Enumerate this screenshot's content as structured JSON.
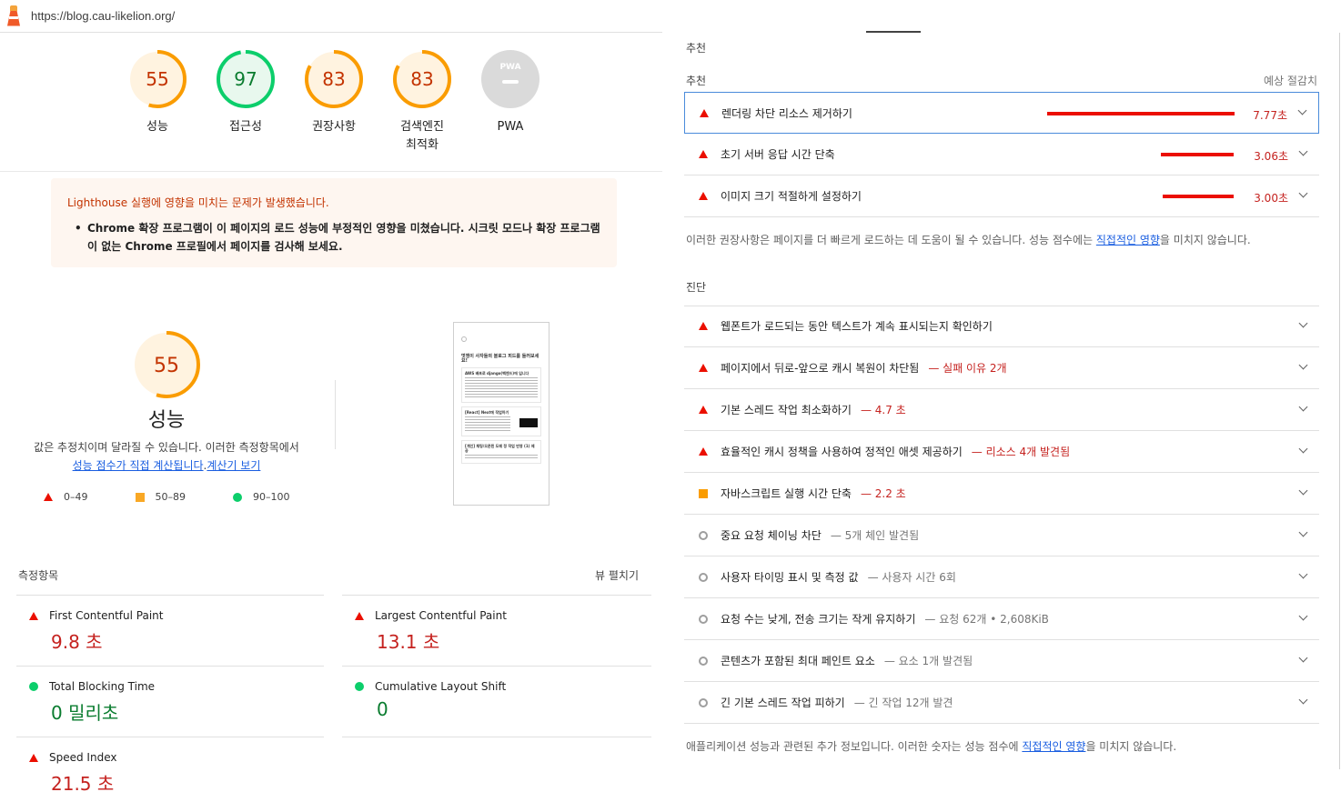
{
  "browser": {
    "url": "https://blog.cau-likelion.org/"
  },
  "gauges": [
    {
      "label": "성능",
      "score": "55",
      "color": "#fa9c00",
      "value": 0.55
    },
    {
      "label": "접근성",
      "score": "97",
      "color": "#0cce6b",
      "value": 0.97
    },
    {
      "label": "권장사항",
      "score": "83",
      "color": "#fa9c00",
      "value": 0.83
    },
    {
      "label": "검색엔진 최적화",
      "score": "83",
      "color": "#fa9c00",
      "value": 0.83
    },
    {
      "label": "PWA",
      "score": "PWA",
      "color": "#9e9e9e",
      "value": 1.0
    }
  ],
  "warning": {
    "title": "Lighthouse 실행에 영향을 미치는 문제가 발생했습니다.",
    "items": [
      "Chrome 확장 프로그램이 이 페이지의 로드 성능에 부정적인 영향을 미쳤습니다. 시크릿 모드나 확장 프로그램이 없는 Chrome 프로필에서 페이지를 검사해 보세요."
    ]
  },
  "performance": {
    "score": "55",
    "title": "성능",
    "desc_prefix": "값은 추정치이며 달라질 수 있습니다. 이러한 측정항목에서",
    "desc_link1": "성능 점수가 직접 계산됩니다",
    "desc_mid": ".",
    "desc_link2": "계산기 보기",
    "legend": [
      "0–49",
      "50–89",
      "90–100"
    ]
  },
  "metrics": {
    "title": "측정항목",
    "expand": "뷰 펼치기",
    "items": [
      {
        "name": "First Contentful Paint",
        "value": "9.8 초",
        "status": "red"
      },
      {
        "name": "Largest Contentful Paint",
        "value": "13.1 초",
        "status": "red"
      },
      {
        "name": "Total Blocking Time",
        "value": "0 밀리초",
        "status": "green"
      },
      {
        "name": "Cumulative Layout Shift",
        "value": "0",
        "status": "green"
      },
      {
        "name": "Speed Index",
        "value": "21.5 초",
        "status": "red"
      }
    ]
  },
  "thumbnail": {
    "title": "멋쟁이 사자들의 블로그 피드를 들러보세요!",
    "cards": [
      "AWS 배포로 django(벡엔드)에 입니다",
      "[React] Next에 작업하기",
      "[개인] 채팅/오픈된 도메 정 작업 반영 (1) 제공"
    ]
  },
  "opportunities": {
    "section": "추천",
    "header": "추천",
    "savings_label": "예상 절감치",
    "items": [
      {
        "text": "렌더링 차단 리소스 제거하기",
        "savings": "7.77초",
        "fraction": 1.0
      },
      {
        "text": "초기 서버 응답 시간 단축",
        "savings": "3.06초",
        "fraction": 0.39
      },
      {
        "text": "이미지 크기 적절하게 설정하기",
        "savings": "3.00초",
        "fraction": 0.38
      }
    ],
    "note_prefix": "이러한 권장사항은 페이지를 더 빠르게 로드하는 데 도움이 될 수 있습니다. 성능 점수에는",
    "note_link": "직접적인 영향",
    "note_suffix": "을 미치지 않습니다."
  },
  "diagnostics": {
    "title": "진단",
    "items": [
      {
        "text": "웹폰트가 로드되는 동안 텍스트가 계속 표시되는지 확인하기",
        "extra": "",
        "status": "red"
      },
      {
        "text": "페이지에서 뒤로-앞으로 캐시 복원이 차단됨",
        "extra": "— 실패 이유 2개",
        "status": "red"
      },
      {
        "text": "기본 스레드 작업 최소화하기",
        "extra": "— 4.7 초",
        "status": "red"
      },
      {
        "text": "효율적인 캐시 정책을 사용하여 정적인 애셋 제공하기",
        "extra": "— 리소스 4개 발견됨",
        "status": "red"
      },
      {
        "text": "자바스크립트 실행 시간 단축",
        "extra": "— 2.2 초",
        "status": "orange"
      },
      {
        "text": "중요 요청 체이닝 차단",
        "extra": "— 5개 체인 발견됨",
        "status": "gray"
      },
      {
        "text": "사용자 타이밍 표시 및 측정 값",
        "extra": "— 사용자 시간 6회",
        "status": "gray"
      },
      {
        "text": "요청 수는 낮게, 전송 크기는 작게 유지하기",
        "extra": "— 요청 62개 • 2,608KiB",
        "status": "gray"
      },
      {
        "text": "콘텐츠가 포함된 최대 페인트 요소",
        "extra": "— 요소 1개 발견됨",
        "status": "gray"
      },
      {
        "text": "긴 기본 스레드 작업 피하기",
        "extra": "— 긴 작업 12개 발견",
        "status": "gray"
      }
    ],
    "note_prefix": "애플리케이션 성능과 관련된 추가 정보입니다. 이러한 숫자는 성능 점수에",
    "note_link": "직접적인 영향",
    "note_suffix": "을 미치지 않습니다."
  }
}
